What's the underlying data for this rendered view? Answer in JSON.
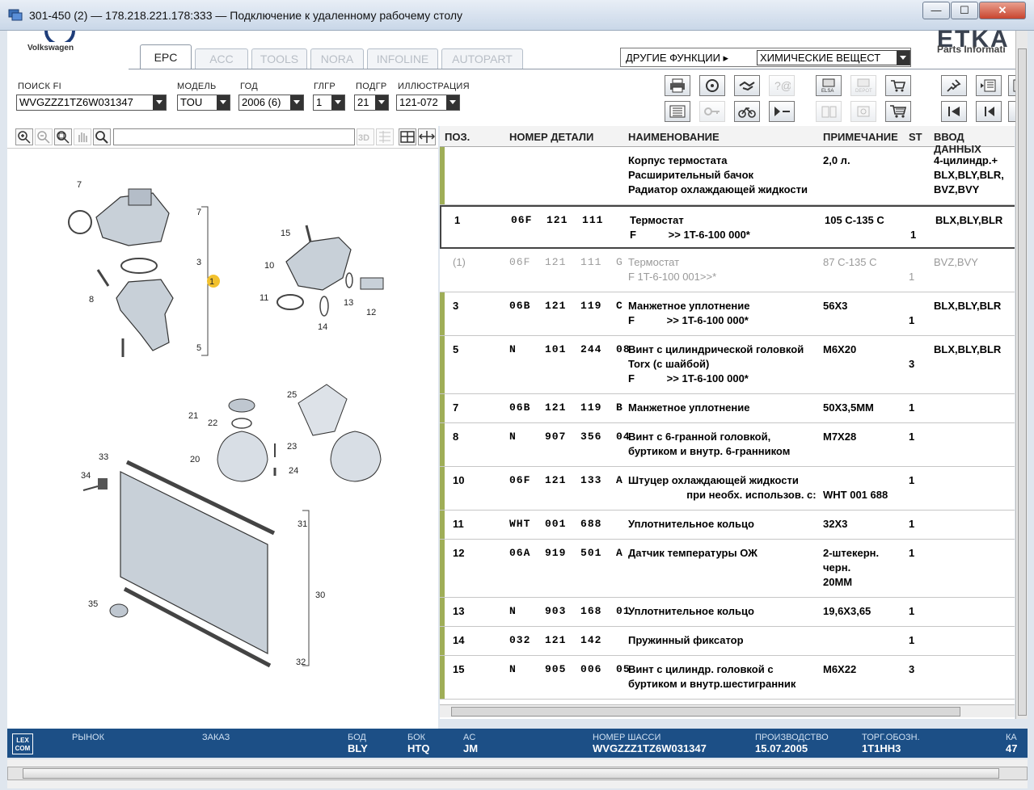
{
  "window": {
    "title": "301-450 (2) — 178.218.221.178:333 — Подключение к удаленному рабочему столу",
    "minimize": "—",
    "maximize": "☐",
    "close": "✕"
  },
  "header": {
    "brand": "Volkswagen",
    "etka_logo": "ETKA",
    "etka_sub": "Parts Informati",
    "tabs": [
      "EPC",
      "ACC",
      "TOOLS",
      "NORA",
      "INFOLINE",
      "AUTOPART"
    ],
    "other_functions_label": "ДРУГИЕ ФУНКЦИИ ▸",
    "other_functions_value": "ХИМИЧЕСКИЕ ВЕЩЕСТ"
  },
  "search": {
    "fi_label": "ПОИСК FI",
    "fi_value": "WVGZZZ1TZ6W031347",
    "model_label": "МОДЕЛЬ",
    "model_value": "TOU",
    "year_label": "ГОД",
    "year_value": "2006 (6)",
    "glgr_label": "ГЛГР",
    "glgr_value": "1",
    "podgr_label": "ПОДГР",
    "podgr_value": "21",
    "illus_label": "ИЛЛЮСТРАЦИЯ",
    "illus_value": "121-072"
  },
  "table": {
    "headers": [
      "ПОЗ.",
      "НОМЕР ДЕТАЛИ",
      "НАИМЕНОВАНИЕ",
      "ПРИМЕЧАНИЕ",
      "ST",
      "ВВОД ДАННЫХ"
    ],
    "rows": [
      {
        "pos": "",
        "num": "",
        "name": "Корпус термостата\nРасширительный бачок\nРадиатор охлаждающей жидкости",
        "note": "2,0 л.",
        "st": "",
        "data": "4-цилиндр.+\nBLX,BLY,BLR,\nBVZ,BVY"
      },
      {
        "pos": "1",
        "num": "06F  121  111",
        "name": "Термостат\nF           >> 1T-6-100 000*",
        "note": "105 С-135 С",
        "st": "\n1",
        "data": "BLX,BLY,BLR"
      },
      {
        "pos": "(1)",
        "num": "06F  121  111  G",
        "name": "Термостат\nF 1T-6-100 001>>*",
        "note": "87 С-135 С",
        "st": "\n1",
        "data": "BVZ,BVY"
      },
      {
        "pos": "3",
        "num": "06B  121  119  C",
        "name": "Манжетное уплотнение\nF           >> 1T-6-100 000*",
        "note": "56X3",
        "st": "\n1",
        "data": "BLX,BLY,BLR"
      },
      {
        "pos": "5",
        "num": "N    101  244  08",
        "name": "Винт с цилиндрической головкой\nTorx (с шайбой)\nF           >> 1T-6-100 000*",
        "note": "M6X20",
        "st": "\n3",
        "data": "BLX,BLY,BLR"
      },
      {
        "pos": "7",
        "num": "06B  121  119  B",
        "name": "Манжетное уплотнение",
        "note": "50X3,5MM",
        "st": "1",
        "data": ""
      },
      {
        "pos": "8",
        "num": "N    907  356  04",
        "name": "Винт с 6-гранной головкой,\nбуртиком и внутр. 6-гранником",
        "note": "M7X28",
        "st": "1",
        "data": ""
      },
      {
        "pos": "10",
        "num": "06F  121  133  A",
        "name": "Штуцер охлаждающей жидкости\n                    при необх. использов. с:",
        "note": "\nWHT 001 688",
        "st": "1",
        "data": ""
      },
      {
        "pos": "11",
        "num": "WHT  001  688",
        "name": "Уплотнительное кольцо",
        "note": "32X3",
        "st": "1",
        "data": ""
      },
      {
        "pos": "12",
        "num": "06A  919  501  A",
        "name": "Датчик температуры ОЖ",
        "note": "2-штекерн.\nчерн.\n20MM",
        "st": "1",
        "data": ""
      },
      {
        "pos": "13",
        "num": "N    903  168  01",
        "name": "Уплотнительное кольцо",
        "note": "19,6X3,65",
        "st": "1",
        "data": ""
      },
      {
        "pos": "14",
        "num": "032  121  142",
        "name": "Пружинный фиксатор",
        "note": "",
        "st": "1",
        "data": ""
      },
      {
        "pos": "15",
        "num": "N    905  006  05",
        "name": "Винт с цилиндр. головкой с\nбуртиком и внутр.шестигранник",
        "note": "M6X22",
        "st": "3",
        "data": ""
      }
    ]
  },
  "illustration": {
    "callouts": [
      "7",
      "7",
      "3",
      "1",
      "8",
      "5",
      "15",
      "10",
      "11",
      "13",
      "12",
      "14",
      "25",
      "21",
      "22",
      "23",
      "20",
      "24",
      "33",
      "34",
      "31",
      "30",
      "35",
      "32"
    ]
  },
  "status": {
    "lexcom": "LEX\nCOM",
    "market_label": "РЫНОК",
    "order_label": "ЗАКАЗ",
    "bod_label": "БОД",
    "bod_value": "BLY",
    "bok_label": "БОК",
    "bok_value": "HTQ",
    "ac_label": "AC",
    "ac_value": "JM",
    "chassis_label": "НОМЕР ШАССИ",
    "chassis_value": "WVGZZZ1TZ6W031347",
    "prod_label": "ПРОИЗВОДСТВО",
    "prod_value": "15.07.2005",
    "trade_label": "ТОРГ.ОБОЗН.",
    "trade_value": "1T1HH3",
    "k_label": "КА",
    "k_value": "47"
  },
  "colors": {
    "status_bg": "#1c4f86",
    "row_marker": "#9fae57",
    "highlight_callout": "#f2c12e"
  }
}
